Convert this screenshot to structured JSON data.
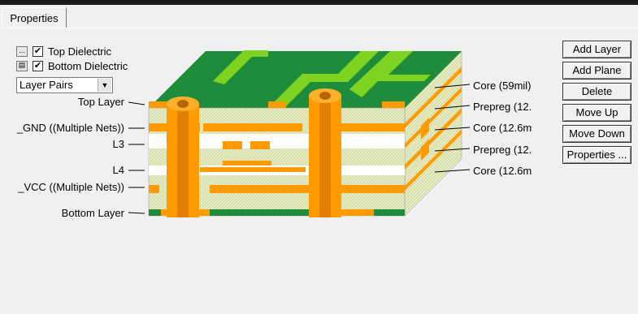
{
  "tab": {
    "label": "Properties"
  },
  "options": {
    "top_dielectric": {
      "label": "Top Dielectric",
      "checked": true
    },
    "bottom_dielectric": {
      "label": "Bottom Dielectric",
      "checked": true
    },
    "small_button_1": "...",
    "view_select": {
      "value": "Layer Pairs"
    }
  },
  "left_labels": {
    "top_layer": "Top Layer",
    "gnd": "_GND ((Multiple Nets))",
    "l3": "L3",
    "l4": "L4",
    "vcc": "_VCC ((Multiple Nets))",
    "bottom_layer": "Bottom Layer"
  },
  "right_labels": {
    "core1": "Core (59mil)",
    "prepreg1": "Prepreg (12.",
    "core2": "Core (12.6m",
    "prepreg2": "Prepreg (12.",
    "core3": "Core (12.6m"
  },
  "buttons": {
    "add_layer": "Add Layer",
    "add_plane": "Add Plane",
    "delete": "Delete",
    "move_up": "Move Up",
    "move_down": "Move Down",
    "properties": "Properties ..."
  },
  "colors": {
    "copper": "#ff9a00",
    "green": "#1e8c3a",
    "dielectric": "#e8ecc4",
    "trace_green": "#7ed321"
  }
}
